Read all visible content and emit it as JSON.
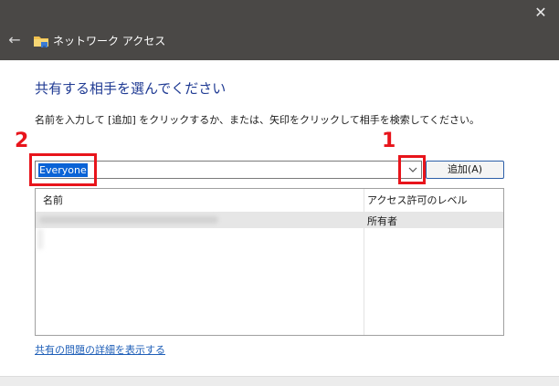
{
  "window": {
    "title": "ネットワーク アクセス",
    "close_glyph": "✕",
    "back_glyph": "←"
  },
  "dialog": {
    "heading": "共有する相手を選んでください",
    "instruction": "名前を入力して [追加] をクリックするか、または、矢印をクリックして相手を検索してください。",
    "input_value": "Everyone",
    "add_button": "追加(A)",
    "table": {
      "columns": [
        "名前",
        "アクセス許可のレベル"
      ],
      "rows": [
        {
          "name": "",
          "permission": "所有者"
        }
      ]
    },
    "help_link": "共有の問題の詳細を表示する"
  },
  "annotations": [
    {
      "label": "1",
      "target": "dropdown-arrow"
    },
    {
      "label": "2",
      "target": "name-input"
    }
  ],
  "colors": {
    "titlebar": "#4a4846",
    "heading": "#1f3a93",
    "annotation": "#e8141b",
    "selection": "#0a63d6",
    "link": "#1f5fb8"
  }
}
